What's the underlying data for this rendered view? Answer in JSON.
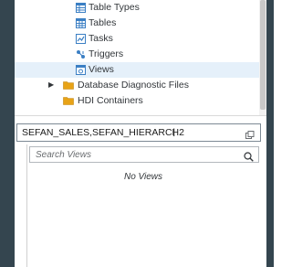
{
  "tree": {
    "items": [
      {
        "label": "Table Types",
        "icon": "table-types-icon"
      },
      {
        "label": "Tables",
        "icon": "table-icon"
      },
      {
        "label": "Tasks",
        "icon": "tasks-icon"
      },
      {
        "label": "Triggers",
        "icon": "triggers-icon"
      },
      {
        "label": "Views",
        "icon": "views-icon",
        "selected": true
      },
      {
        "label": "Database Diagnostic Files",
        "icon": "folder-icon",
        "caret": "expand"
      },
      {
        "label": "HDI Containers",
        "icon": "folder-icon"
      }
    ]
  },
  "filter": {
    "value": "SEFAN_SALES,SEFAN_HIERARCH2"
  },
  "views_panel": {
    "search_placeholder": "Search Views",
    "empty_text": "No Views"
  },
  "colors": {
    "sidebar": "#34454f",
    "selection": "#e5f0fa",
    "folder": "#e8a317",
    "icon_blue": "#3b7fc4"
  }
}
